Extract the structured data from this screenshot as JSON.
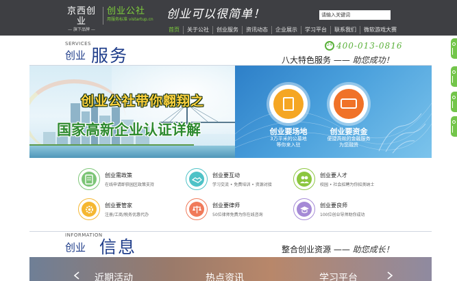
{
  "header": {
    "logo_a": {
      "title": "京西创业",
      "subtitle": "— 旗下品牌 —"
    },
    "logo_b": {
      "title": "创业公社",
      "subtitle": "用服务标准 vistartup.cn"
    },
    "slogan": "创业可以很简单！",
    "search": {
      "placeholder": "请输入关键词",
      "value": "请输入关键词"
    },
    "nav": [
      {
        "label": "首页",
        "active": true
      },
      {
        "label": "关于公社"
      },
      {
        "label": "创业服务"
      },
      {
        "label": "资讯动态"
      },
      {
        "label": "企业展示"
      },
      {
        "label": "学习平台"
      },
      {
        "label": "联系我们"
      },
      {
        "label": "微软游戏大赛"
      }
    ]
  },
  "services": {
    "heading_en": "SERVICES",
    "heading_cn_small": "创业",
    "heading_cn_big": "服务",
    "hotline_badge": "24",
    "hotline": "400-013-0816",
    "tagline_text": "八大特色服务 ——",
    "tagline_script": "助您成功！",
    "banner": {
      "line1": "创业公社带你翱翔之",
      "line2": "国家高新企业认证详解",
      "feature_a": {
        "title": "创业要场地",
        "desc_1": "3万平米的公墓地",
        "desc_2": "等你来入驻"
      },
      "feature_b": {
        "title": "创业要资金",
        "desc_1": "便捷高效的金融服务",
        "desc_2": "为您融资"
      }
    },
    "items": [
      {
        "title": "创业需政策",
        "desc": "在线申请即获园区政策支持",
        "color": "#7cc576",
        "icon": "document-icon"
      },
      {
        "title": "创业要互动",
        "desc": "学习交流 • 免费培训 • 资源对接",
        "color": "#4ec2c7",
        "icon": "handshake-icon"
      },
      {
        "title": "创业要人才",
        "desc": "校园 • 社会招聘为你招贤纳士",
        "color": "#8cc63f",
        "icon": "people-icon"
      },
      {
        "title": "创业要管家",
        "desc": "注册/工商/税务优惠代办",
        "color": "#f5b731",
        "icon": "gear-icon"
      },
      {
        "title": "创业要律师",
        "desc": "50位律师免费为你在线咨询",
        "color": "#f07a5a",
        "icon": "scale-icon"
      },
      {
        "title": "创业要良师",
        "desc": "100位创业导师助你成功",
        "color": "#a58ad6",
        "icon": "graduation-cap-icon"
      }
    ]
  },
  "information": {
    "heading_en": "INFORMATION",
    "heading_cn_small": "创业",
    "heading_cn_big": "信息",
    "tagline_text": "整合创业资源 ——",
    "tagline_script": "助您成长！",
    "tabs": [
      {
        "label": "近期活动"
      },
      {
        "label": "热点资讯"
      },
      {
        "label": "学习平台"
      }
    ]
  }
}
